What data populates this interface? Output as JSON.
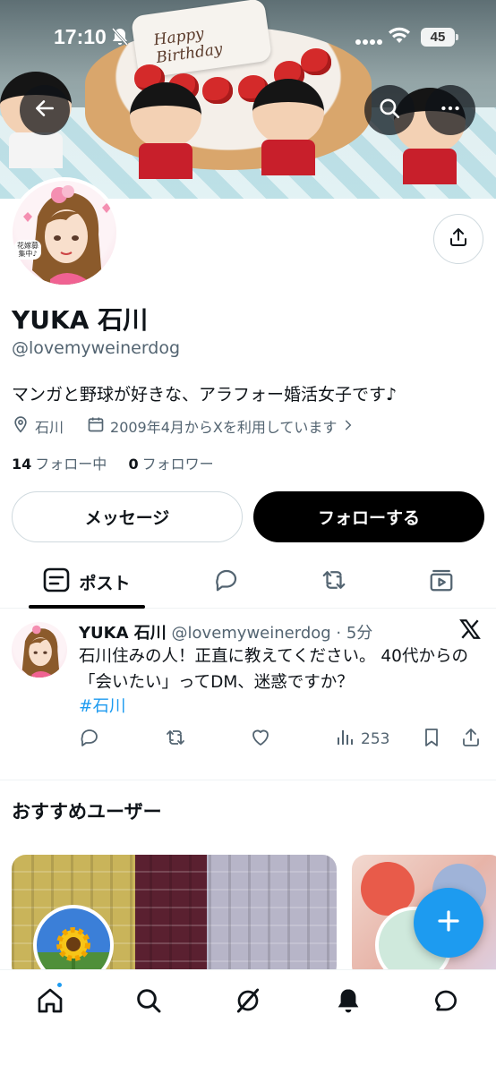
{
  "status_bar": {
    "time": "17:10",
    "battery": "45"
  },
  "banner": {
    "plate_text": "Happy Birthday"
  },
  "profile": {
    "name": "YUKA 石川",
    "handle": "@lovemyweinerdog",
    "bio": "マンガと野球が好きな、アラフォー婚活女子です♪",
    "location": "石川",
    "joined": "2009年4月からXを利用しています",
    "following_count": "14",
    "following_label": "フォロー中",
    "followers_count": "0",
    "followers_label": "フォロワー",
    "avatar_badge": "花嫁募集中♪"
  },
  "buttons": {
    "message": "メッセージ",
    "follow": "フォローする"
  },
  "tabs": {
    "posts": "ポスト"
  },
  "post": {
    "author": "YUKA 石川",
    "meta": "@lovemyweinerdog · 5分",
    "text": "石川住みの人！正直に教えてください。 40代からの「会いたい」ってDM、迷惑ですか？",
    "hashtag": "#石川",
    "views": "253"
  },
  "recommendations": {
    "title": "おすすめユーザー"
  },
  "colors": {
    "accent": "#1d9bf0",
    "text": "#0f1419",
    "secondary": "#536471",
    "border": "#cfd9de"
  },
  "icons": [
    "back-arrow-icon",
    "search-icon",
    "more-icon",
    "share-icon",
    "location-icon",
    "calendar-icon",
    "chevron-right-icon",
    "post-tab-icon",
    "reply-tab-icon",
    "repost-tab-icon",
    "media-tab-icon",
    "x-logo-icon",
    "reply-icon",
    "repost-icon",
    "like-icon",
    "views-icon",
    "bookmark-icon",
    "share-post-icon",
    "plus-icon",
    "home-icon",
    "explore-icon",
    "grok-icon",
    "notifications-icon",
    "messages-icon"
  ]
}
